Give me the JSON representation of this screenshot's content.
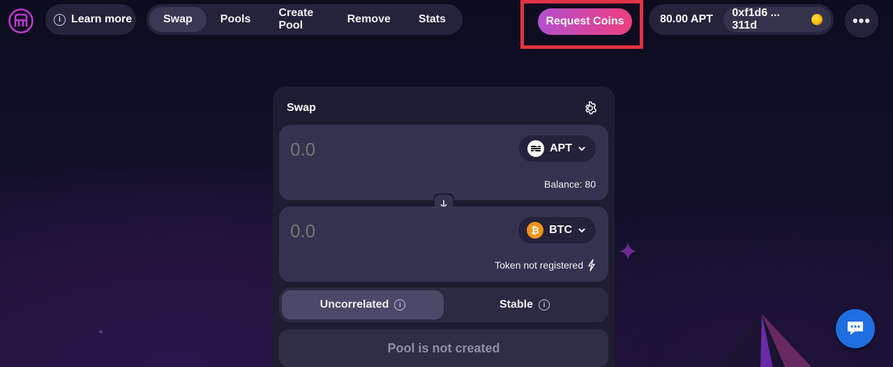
{
  "header": {
    "logo_icon": "liquidswap-logo-icon",
    "learn_more": "Learn more",
    "nav": [
      {
        "label": "Swap",
        "active": true
      },
      {
        "label": "Pools",
        "active": false
      },
      {
        "label": "Create Pool",
        "active": false
      },
      {
        "label": "Remove",
        "active": false
      },
      {
        "label": "Stats",
        "active": false
      }
    ],
    "request_coins": "Request Coins",
    "wallet_balance": "80.00 APT",
    "wallet_address": "0xf1d6 ... 311d",
    "more_label": "•••",
    "highlight_color": "#e33242"
  },
  "swap": {
    "title": "Swap",
    "from": {
      "amount_placeholder": "0.0",
      "token": "APT",
      "footer": "Balance: 80"
    },
    "to": {
      "amount_placeholder": "0.0",
      "token": "BTC",
      "footer": "Token not registered"
    },
    "curve_options": [
      {
        "label": "Uncorrelated",
        "active": true
      },
      {
        "label": "Stable",
        "active": false
      }
    ],
    "pool_status": "Pool is not created"
  },
  "colors": {
    "accent_gradient_start": "#b44fd0",
    "accent_gradient_end": "#ee3f7d",
    "btc": "#f7931a",
    "chat": "#1e6ee0"
  }
}
